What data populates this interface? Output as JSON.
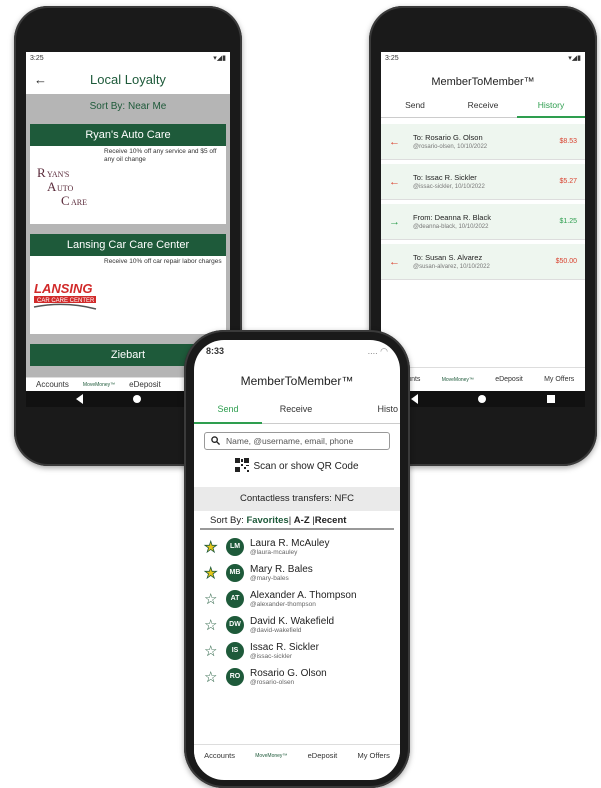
{
  "phone1": {
    "status_time": "3:25",
    "title": "Local Loyalty",
    "sort_label": "Sort By: Near Me",
    "businesses": [
      {
        "name": "Ryan's Auto Care",
        "description": "Receive 10% off any service and $5 off any oil change",
        "logo_text": "RYAN'S AUTO CARE"
      },
      {
        "name": "Lansing Car Care Center",
        "description": "Receive 10% off car repair labor charges",
        "logo_text": "LANSING CAR CARE CENTER"
      },
      {
        "name": "Ziebart",
        "description": "",
        "logo_text": ""
      }
    ],
    "bottom_tabs": [
      "Accounts",
      "MoveMoney™",
      "eDeposit"
    ]
  },
  "phone2": {
    "status_time": "3:25",
    "title": "MemberToMember™",
    "tabs": [
      "Send",
      "Receive",
      "History"
    ],
    "active_tab": "History",
    "transactions": [
      {
        "name": "To: Rosario G. Olson",
        "sub": "@rosario-olsen, 10/10/2022",
        "amount": "$8.53",
        "direction": "out"
      },
      {
        "name": "To: Issac R. Sickler",
        "sub": "@issac-sickler, 10/10/2022",
        "amount": "$5.27",
        "direction": "out"
      },
      {
        "name": "From: Deanna R. Black",
        "sub": "@deanna-black, 10/10/2022",
        "amount": "$1.25",
        "direction": "in"
      },
      {
        "name": "To: Susan S. Alvarez",
        "sub": "@susan-alvarez, 10/10/2022",
        "amount": "$50.00",
        "direction": "out"
      }
    ],
    "bottom_tabs": [
      "Accounts",
      "MoveMoney™",
      "eDeposit",
      "My Offers"
    ]
  },
  "phone3": {
    "status_time": "8:33",
    "title": "MemberToMember™",
    "tabs": [
      "Send",
      "Receive",
      "Histo"
    ],
    "active_tab": "Send",
    "search_placeholder": "Name, @username, email, phone",
    "qr_label": "Scan or show QR Code",
    "nfc_label": "Contactless transfers: NFC",
    "sort_prefix": "Sort By:",
    "sort_options": [
      "Favorites",
      "A-Z",
      "Recent"
    ],
    "contacts": [
      {
        "initials": "LM",
        "name": "Laura R. McAuley",
        "username": "@laura-mcauley",
        "favorite": true
      },
      {
        "initials": "MB",
        "name": "Mary R. Bales",
        "username": "@mary-bales",
        "favorite": true
      },
      {
        "initials": "AT",
        "name": "Alexander A. Thompson",
        "username": "@alexander-thompson",
        "favorite": false
      },
      {
        "initials": "DW",
        "name": "David K. Wakefield",
        "username": "@david-wakefield",
        "favorite": false
      },
      {
        "initials": "IS",
        "name": "Issac R. Sickler",
        "username": "@issac-sickler",
        "favorite": false
      },
      {
        "initials": "RO",
        "name": "Rosario G. Olson",
        "username": "@rosario-olsen",
        "favorite": false
      }
    ],
    "bottom_tabs": [
      "Accounts",
      "MoveMoney™",
      "eDeposit",
      "My Offers"
    ]
  },
  "colors": {
    "brand_green": "#1e5a3a",
    "accent_green": "#2e9e4f",
    "negative_red": "#d9412e"
  }
}
